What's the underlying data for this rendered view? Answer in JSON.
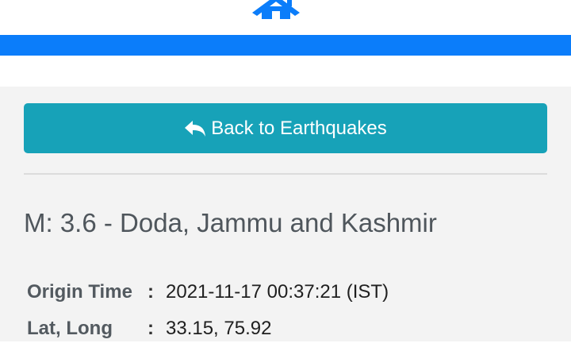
{
  "colors": {
    "accent_blue": "#0b7dfa",
    "button_teal": "#17a2b8",
    "page_background": "#f3f3f3"
  },
  "header": {
    "icon": "home-icon"
  },
  "back_button": {
    "icon": "reply-icon",
    "label": "Back to Earthquakes"
  },
  "event": {
    "title": "M: 3.6 - Doda, Jammu and Kashmir",
    "details": [
      {
        "label": "Origin Time",
        "separator": ":",
        "value": "2021-11-17 00:37:21 (IST)"
      },
      {
        "label": "Lat, Long",
        "separator": ":",
        "value": "33.15, 75.92"
      }
    ]
  }
}
